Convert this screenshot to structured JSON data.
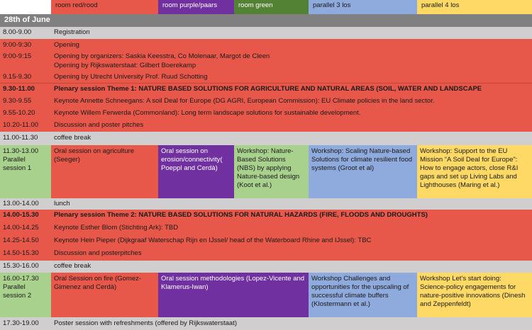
{
  "header": {
    "rooms": [
      "room red/rood",
      "room purple/paars",
      "room green",
      "parallel 3 los",
      "parallel 4 los"
    ]
  },
  "date": "28th of June",
  "rows": {
    "registration": {
      "time": "8.00-9.00",
      "text": "Registration"
    },
    "opening": {
      "time": "9:00-9:30",
      "text": "Opening"
    },
    "opening_org": {
      "time": "9:00-9:15",
      "text": "Opening by organizers: Saskia Keesstra, Co Molenaar, Margot de Cleen"
    },
    "opening_rws": {
      "text": "Opening by Rijkswaterstaat: Gilbert Boerekamp"
    },
    "opening_uu": {
      "time": "9.15-9.30",
      "text": "Opening by Utrecht University Prof. Ruud Schotting"
    },
    "plenary1": {
      "time": "9.30-11.00",
      "text": "Plenary session Theme 1: NATURE BASED SOLUTIONS FOR AGRICULTURE AND NATURAL AREAS (SOIL, WATER AND LANDSCAPE"
    },
    "keynote1": {
      "time": "9.30-9.55",
      "text": "Keynote Annette Schneegans: A soil Deal for Europe (DG AGRI, European Commission): EU Climate policies in the land sector."
    },
    "keynote2": {
      "time": "9.55-10.20",
      "text": "Keynote Willem Ferwerda (Commonland): Long term landscape solutions for sustainable development."
    },
    "pitches1": {
      "time": "10.20-11.00",
      "text": "Discussion and poster pitches"
    },
    "coffee1": {
      "time": "11.00-11.30",
      "text": "coffee break"
    },
    "parallel1": {
      "time": "11.30-13.00",
      "label": "Parallel session 1",
      "red": "Oral session on agriculture (Seeger)",
      "purple": "Oral session on erosion/connectivity( Poeppl and Cerdà)",
      "green": "Workshop: Nature-Based Solutions (NBS) by applying Nature-based design (Koot et al.)",
      "blue": "Workshop: Scaling Nature-based Solutions for climate resilient food systems (Groot et al)",
      "yellow": "Workshop: Support to the EU Mission “A Soil Deal for Europe”: How to engage actors, close R&I gaps and set up Living Labs and Lighthouses (Maring et al.)"
    },
    "lunch": {
      "time": "13.00-14.00",
      "text": "lunch"
    },
    "plenary2": {
      "time": "14.00-15.30",
      "text": "Plenary session Theme 2: NATURE BASED SOLUTIONS FOR NATURAL HAZARDS (FIRE, FLOODS AND DROUGHTS)"
    },
    "keynote3": {
      "time": "14.00-14.25",
      "text": "Keynote Esther Blom (Stichting Ark): TBD"
    },
    "keynote4": {
      "time": "14.25-14.50",
      "text": "Keynote Hein Pieper (Dijkgraaf Waterschap Rijn en IJssel/ head of the Waterboard Rhine and IJssel): TBC"
    },
    "pitches2": {
      "time": "14.50-15.30",
      "text": "Discussion and posterpitches"
    },
    "coffee2": {
      "time": "15.30-16.00",
      "text": "coffee break"
    },
    "parallel2": {
      "time": "16.00-17.30",
      "label": "Parallel session 2",
      "red": "Oral Session on fire (Gomez-Gimenez and Cerdà)",
      "purple": "Oral session methodologies (Lopez-Vicente and Klamerus-Iwan)",
      "blue": "Workshop Challenges and opportunities for the upscaling of successful climate buffers (Klostermann et al.)",
      "yellow": "Workshop Let’s start doing: Science-policy engagements for nature-positive innovations (Dinesh and Zeppenfeldt)"
    },
    "poster": {
      "time": "17.30-19.00",
      "text": "Poster session with refreshments (offered by Rijkswaterstaat)"
    }
  },
  "colors": {
    "red": "#e8584a",
    "purple": "#7030a0",
    "green": "#548235",
    "light_green": "#a9d18e",
    "blue": "#8faadc",
    "yellow": "#ffd966",
    "grey": "#d0cece",
    "date_bar": "#808080"
  }
}
